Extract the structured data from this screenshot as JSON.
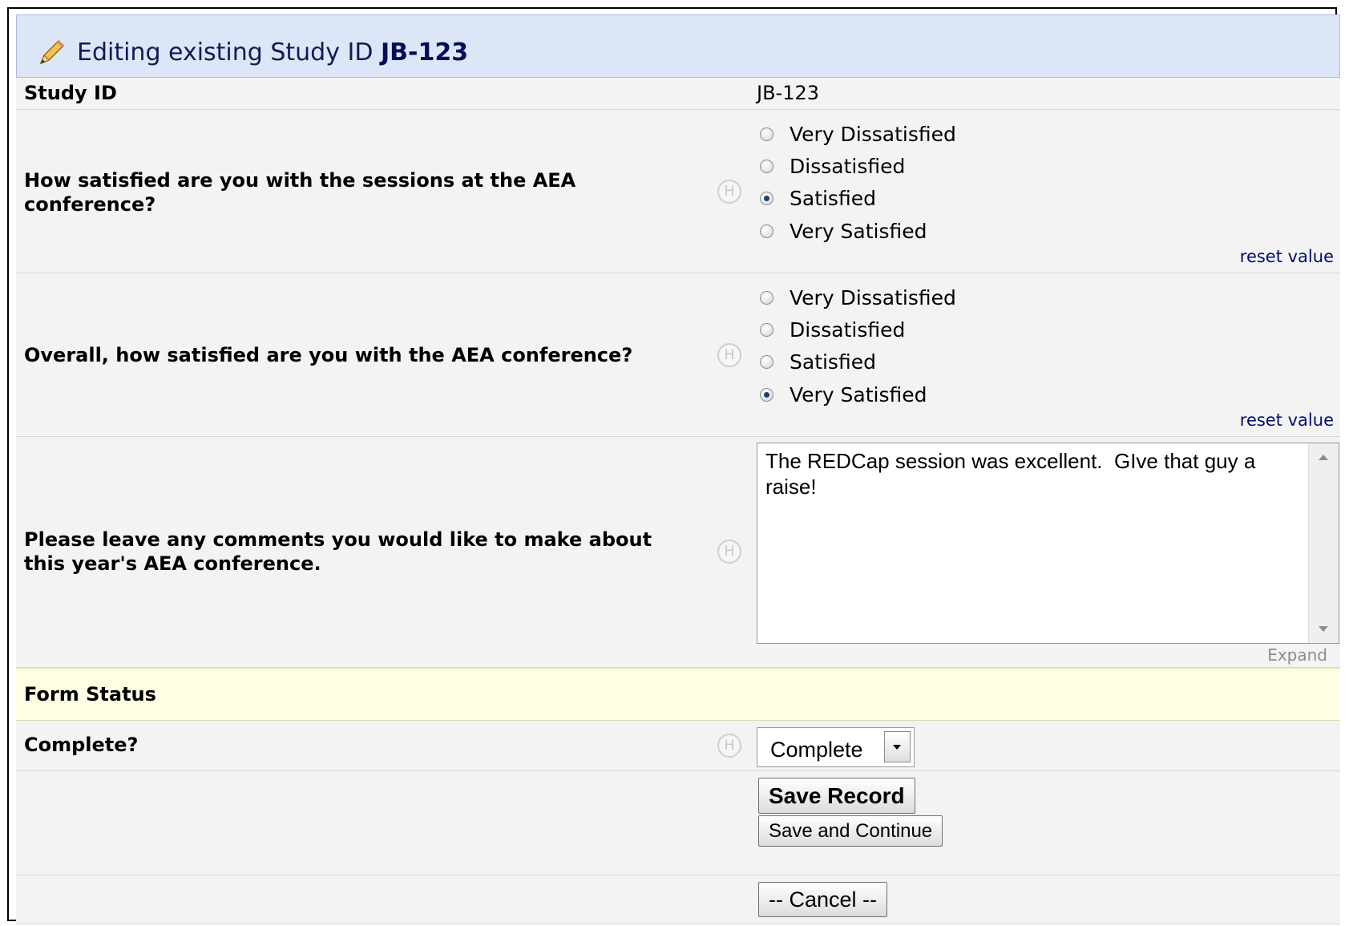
{
  "header": {
    "prefix": "Editing existing Study ID",
    "record_id": "JB-123"
  },
  "study_id": {
    "label": "Study ID",
    "value": "JB-123"
  },
  "questions": [
    {
      "label": "How satisfied are you with the sessions at the AEA conference?",
      "options": [
        "Very Dissatisfied",
        "Dissatisfied",
        "Satisfied",
        "Very Satisfied"
      ],
      "selected": "Satisfied",
      "reset_label": "reset value"
    },
    {
      "label": "Overall, how satisfied are you with the AEA conference?",
      "options": [
        "Very Dissatisfied",
        "Dissatisfied",
        "Satisfied",
        "Very Satisfied"
      ],
      "selected": "Very Satisfied",
      "reset_label": "reset value"
    }
  ],
  "comments": {
    "label": "Please leave any comments you would like to make about this year's AEA conference.",
    "value": "The REDCap session was excellent.  GIve that guy a raise!",
    "expand_label": "Expand"
  },
  "form_status": {
    "section_label": "Form Status",
    "complete_label": "Complete?",
    "complete_value": "Complete"
  },
  "help_icon_glyph": "H",
  "buttons": {
    "save_record": "Save Record",
    "save_continue": "Save and Continue",
    "cancel": "-- Cancel --"
  }
}
